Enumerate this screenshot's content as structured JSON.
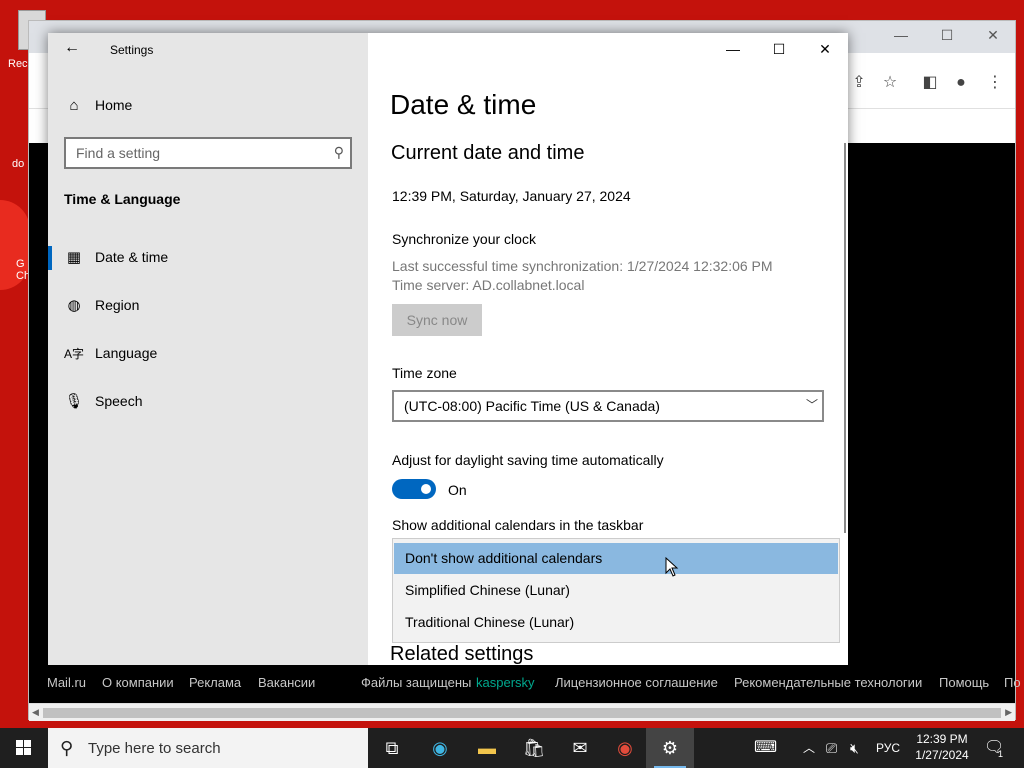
{
  "desktop": {
    "icon1_label": "Rec",
    "icon2_label": "do",
    "icon3_label": "G Ch"
  },
  "browser": {
    "controls": {
      "minimize": "—",
      "maximize": "☐",
      "close": "✕"
    },
    "footer_links": [
      "Mail.ru",
      "О компании",
      "Реклама",
      "Вакансии",
      "Файлы защищены",
      "kaspersky",
      "Лицензионное соглашение",
      "Рекомендательные технологии",
      "Помощь",
      "По"
    ]
  },
  "settings": {
    "app_title": "Settings",
    "controls": {
      "minimize": "—",
      "maximize": "☐",
      "close": "✕"
    },
    "nav": {
      "home_label": "Home",
      "search_placeholder": "Find a setting",
      "section_title": "Time & Language",
      "items": [
        {
          "label": "Date & time",
          "icon": "clock-calendar-icon",
          "selected": true
        },
        {
          "label": "Region",
          "icon": "globe-icon",
          "selected": false
        },
        {
          "label": "Language",
          "icon": "language-icon",
          "selected": false
        },
        {
          "label": "Speech",
          "icon": "microphone-icon",
          "selected": false
        }
      ]
    },
    "main": {
      "page_title": "Date & time",
      "current_section_title": "Current date and time",
      "current_datetime": "12:39 PM, Saturday, January 27, 2024",
      "sync_title": "Synchronize your clock",
      "sync_last": "Last successful time synchronization: 1/27/2024 12:32:06 PM",
      "sync_server": "Time server: AD.collabnet.local",
      "sync_button": "Sync now",
      "timezone_label": "Time zone",
      "timezone_value": "(UTC-08:00) Pacific Time (US & Canada)",
      "dst_label": "Adjust for daylight saving time automatically",
      "dst_toggle_state": "On",
      "calendars_label": "Show additional calendars in the taskbar",
      "calendar_options": [
        "Don't show additional calendars",
        "Simplified Chinese (Lunar)",
        "Traditional Chinese (Lunar)"
      ],
      "calendar_selected_index": 0,
      "related_settings": "Related settings"
    }
  },
  "taskbar": {
    "search_placeholder": "Type here to search",
    "language": "РУС",
    "time": "12:39 PM",
    "date": "1/27/2024",
    "notification_count": "1"
  },
  "colors": {
    "desktop_bg": "#c4120c",
    "accent": "#0067c0",
    "selected_option": "#8ab8e0",
    "kaspersky_green": "#00a88e"
  }
}
